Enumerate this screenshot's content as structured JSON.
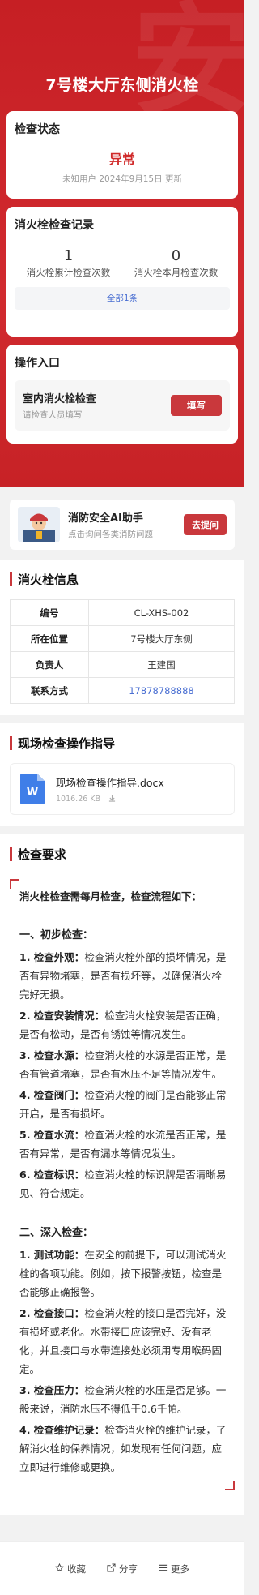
{
  "header": {
    "title": "7号楼大厅东侧消火栓",
    "watermark": "安"
  },
  "status": {
    "title": "检查状态",
    "value": "异常",
    "meta": "未知用户  2024年9月15日 更新",
    "value_color": "#d02a2a"
  },
  "records": {
    "title": "消火栓检查记录",
    "stats": [
      {
        "num": "1",
        "label": "消火栓累计检查次数"
      },
      {
        "num": "0",
        "label": "消火栓本月检查次数"
      }
    ],
    "all_label": "全部1条"
  },
  "entry": {
    "title": "操作入口",
    "item_title": "室内消火栓检查",
    "item_sub": "请检查人员填写",
    "button": "填写"
  },
  "ai": {
    "title": "消防安全AI助手",
    "sub": "点击询问各类消防问题",
    "button": "去提问"
  },
  "info": {
    "title": "消火栓信息",
    "rows": [
      {
        "k": "编号",
        "v": "CL-XHS-002"
      },
      {
        "k": "所在位置",
        "v": "7号楼大厅东侧"
      },
      {
        "k": "负责人",
        "v": "王建国"
      },
      {
        "k": "联系方式",
        "v": "17878788888"
      }
    ]
  },
  "guide": {
    "title": "现场检查操作指导",
    "file_name": "现场检查操作指导.docx",
    "file_size": "1016.26 KB",
    "file_icon_letter": "W"
  },
  "requirements": {
    "title": "检查要求",
    "intro": "消火栓检查需每月检查，检查流程如下：",
    "section1_title": "一、初步检查：",
    "section1": [
      {
        "label": "1. 检查外观：",
        "text": "检查消火栓外部的损坏情况，是否有异物堵塞，是否有损坏等，以确保消火栓完好无损。"
      },
      {
        "label": "2. 检查安装情况：",
        "text": "检查消火栓安装是否正确，是否有松动，是否有锈蚀等情况发生。"
      },
      {
        "label": "3. 检查水源：",
        "text": "检查消火栓的水源是否正常，是否有管道堵塞，是否有水压不足等情况发生。"
      },
      {
        "label": "4. 检查阀门：",
        "text": "检查消火栓的阀门是否能够正常开启，是否有损坏。"
      },
      {
        "label": "5. 检查水流：",
        "text": "检查消火栓的水流是否正常，是否有异常，是否有漏水等情况发生。"
      },
      {
        "label": "6. 检查标识：",
        "text": "检查消火栓的标识牌是否清晰易见、符合规定。"
      }
    ],
    "section2_title": "二、深入检查：",
    "section2": [
      {
        "label": "1. 测试功能：",
        "text": "在安全的前提下，可以测试消火栓的各项功能。例如，按下报警按钮，检查是否能够正确报警。"
      },
      {
        "label": "2. 检查接口：",
        "text": "检查消火栓的接口是否完好，没有损坏或老化。水带接口应该完好、没有老化，并且接口与水带连接处必须用专用喉码固定。"
      },
      {
        "label": "3. 检查压力：",
        "text": "检查消火栓的水压是否足够。一般来说，消防水压不得低于0.6千帕。"
      },
      {
        "label": "4. 检查维护记录：",
        "text": "检查消火栓的维护记录，了解消火栓的保养情况，如发现有任何问题，应立即进行维修或更换。"
      }
    ]
  },
  "bottom": {
    "collect": "收藏",
    "share": "分享",
    "more": "更多"
  },
  "colors": {
    "brand_red": "#c61f24",
    "button_red": "#c9383c",
    "link_blue": "#4a6fd2"
  }
}
